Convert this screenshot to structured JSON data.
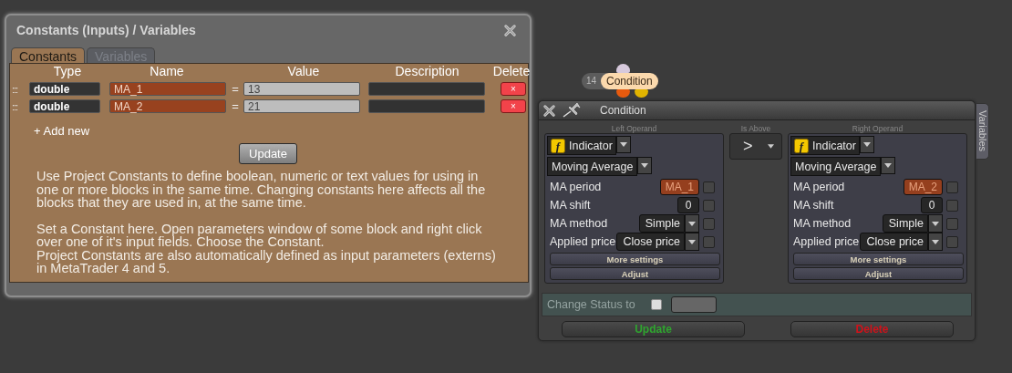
{
  "constants_window": {
    "title": "Constants (Inputs) / Variables",
    "tabs": [
      {
        "label": "Constants",
        "selected": true
      },
      {
        "label": "Variables",
        "selected": false
      }
    ],
    "columns": [
      "Type",
      "Name",
      "Value",
      "Description",
      "Delete"
    ],
    "rows": [
      {
        "handle": ":::",
        "type": "double",
        "name": "MA_1",
        "equals": "=",
        "value": "13",
        "delete": "×"
      },
      {
        "handle": ":::",
        "type": "double",
        "name": "MA_2",
        "equals": "=",
        "value": "21",
        "delete": "×"
      }
    ],
    "add_new": "+ Add new",
    "update": "Update",
    "help": [
      "Use Project Constants to define boolean, numeric or text values for using in one or more blocks in the same time. Changing constants here affects all the blocks that they are used in, at the same time.",
      "Set a Constant here. Open parameters window of some block and right click over one of it's input fields. Choose the Constant.",
      "Project Constants are also automatically defined as input parameters (externs) in MetaTrader 4 and 5."
    ]
  },
  "node": {
    "number": "14",
    "label": "Condition"
  },
  "condition_window": {
    "title": "Condition",
    "side_tab": "Variables",
    "operator_caption": "Is Above",
    "operator": ">",
    "operands": [
      {
        "caption": "Left Operand",
        "icon_letter": "f",
        "source": "Indicator",
        "indicator": "Moving Average",
        "params": [
          {
            "kind": "input",
            "label": "MA period",
            "value": "MA_1",
            "linked": true,
            "checked": false
          },
          {
            "kind": "input",
            "label": "MA shift",
            "value": "0",
            "linked": false,
            "checked": false
          },
          {
            "kind": "select",
            "label": "MA method",
            "value": "Simple",
            "checked": false
          },
          {
            "kind": "select",
            "label": "Applied price",
            "value": "Close price",
            "checked": false
          }
        ],
        "buttons": [
          "More settings",
          "Adjust"
        ]
      },
      {
        "caption": "Right Operand",
        "icon_letter": "f",
        "source": "Indicator",
        "indicator": "Moving Average",
        "params": [
          {
            "kind": "input",
            "label": "MA period",
            "value": "MA_2",
            "linked": true,
            "checked": false
          },
          {
            "kind": "input",
            "label": "MA shift",
            "value": "0",
            "linked": false,
            "checked": false
          },
          {
            "kind": "select",
            "label": "MA method",
            "value": "Simple",
            "checked": false
          },
          {
            "kind": "select",
            "label": "Applied price",
            "value": "Close price",
            "checked": false
          }
        ],
        "buttons": [
          "More settings",
          "Adjust"
        ]
      }
    ],
    "status": {
      "label": "Change Status to",
      "checked": false
    },
    "actions": [
      {
        "kind": "update",
        "label": "Update"
      },
      {
        "kind": "delete",
        "label": "Delete"
      }
    ]
  }
}
